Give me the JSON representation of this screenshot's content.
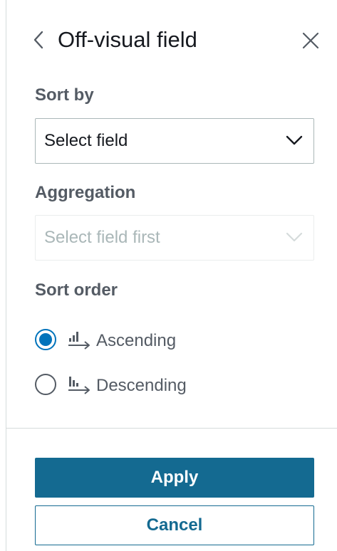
{
  "header": {
    "back_icon": "chevron-left-icon",
    "title": "Off-visual field",
    "close_icon": "close-icon"
  },
  "sort_by": {
    "label": "Sort by",
    "value": "Select field",
    "icon": "chevron-down-icon"
  },
  "aggregation": {
    "label": "Aggregation",
    "placeholder": "Select field first",
    "disabled": true,
    "icon": "chevron-down-icon"
  },
  "sort_order": {
    "label": "Sort order",
    "options": [
      {
        "label": "Ascending",
        "icon": "sort-ascending-icon",
        "selected": true
      },
      {
        "label": "Descending",
        "icon": "sort-descending-icon",
        "selected": false
      }
    ]
  },
  "footer": {
    "apply_label": "Apply",
    "cancel_label": "Cancel"
  },
  "colors": {
    "accent": "#0073bb",
    "primary_button": "#146a91",
    "label_text": "#545b64",
    "disabled_text": "#aab7b8"
  }
}
